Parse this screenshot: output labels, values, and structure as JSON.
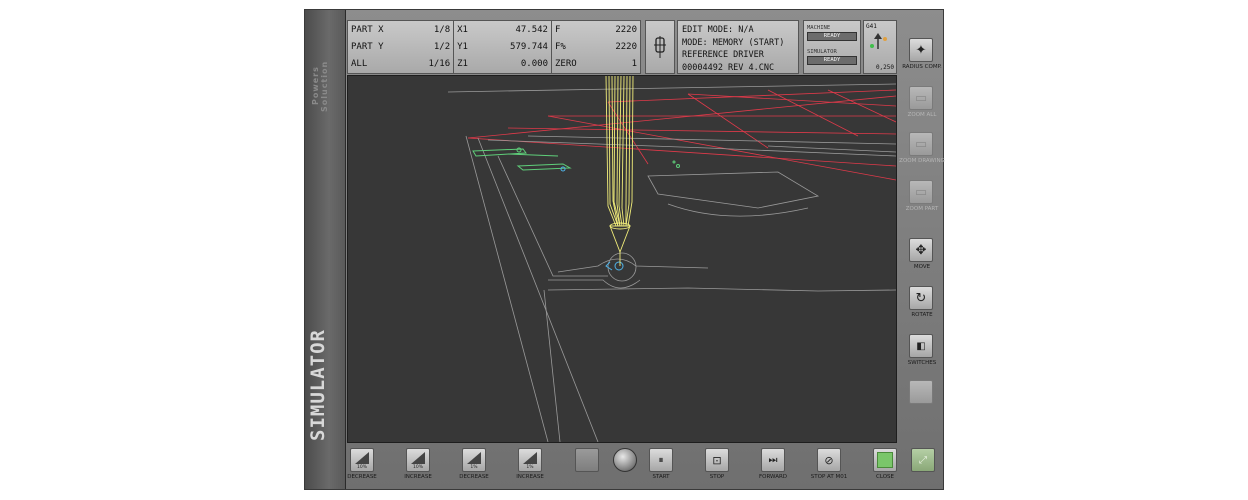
{
  "app": {
    "logo_text": "Powers Soluction",
    "title": "SIMULATOR"
  },
  "coords": {
    "rows": [
      {
        "label": "PART X",
        "count": "1/8",
        "axis": "X1",
        "axis_value": "47.542",
        "param": "F",
        "param_value": "2220"
      },
      {
        "label": "PART Y",
        "count": "1/2",
        "axis": "Y1",
        "axis_value": "579.744",
        "param": "F%",
        "param_value": "2220"
      },
      {
        "label": "ALL",
        "count": "1/16",
        "axis": "Z1",
        "axis_value": "0.000",
        "param": "ZERO",
        "param_value": "1"
      }
    ]
  },
  "modes": {
    "edit_mode": "EDIT MODE: N/A",
    "mode": "MODE: MEMORY (START)",
    "driver": "REFERENCE DRIVER",
    "program": "00004492 REV 4.CNC"
  },
  "status": {
    "machine_label": "MACHINE",
    "machine_state": "READY",
    "simulator_label": "SIMULATOR",
    "simulator_state": "READY"
  },
  "compensation": {
    "code": "G41",
    "value": "0,250"
  },
  "right_toolbar": [
    {
      "label": "RADIUS COMP.",
      "icon": "radius-comp-icon",
      "enabled": true
    },
    {
      "label": "ZOOM ALL",
      "icon": "zoom-all-icon",
      "enabled": false
    },
    {
      "label": "ZOOM DRAWING",
      "icon": "zoom-drawing-icon",
      "enabled": false
    },
    {
      "label": "ZOOM PART",
      "icon": "zoom-part-icon",
      "enabled": false
    },
    {
      "label": "MOVE",
      "icon": "move-icon",
      "enabled": true
    },
    {
      "label": "ROTATE",
      "icon": "rotate-icon",
      "enabled": true
    },
    {
      "label": "SWITCHES",
      "icon": "switches-icon",
      "enabled": true
    }
  ],
  "bottom_toolbar": [
    {
      "label": "DECREASE",
      "pct": "10%"
    },
    {
      "label": "INCREASE",
      "pct": "10%"
    },
    {
      "label": "DECREASE",
      "pct": "1%"
    },
    {
      "label": "INCREASE",
      "pct": "1%"
    },
    {
      "label": "START"
    },
    {
      "label": "STOP"
    },
    {
      "label": "FORWARD"
    },
    {
      "label": "STOP AT M01"
    },
    {
      "label": "CLOSE"
    }
  ],
  "colors": {
    "viewport_bg": "#373737",
    "grid_red": "#e03a4a",
    "toolpath_yellow": "#f2ee7a",
    "contour_green": "#5fcf7a",
    "contour_blue": "#4fb3e8",
    "part_outline": "#9a9a9a",
    "green_indicator": "#7ac66a"
  }
}
